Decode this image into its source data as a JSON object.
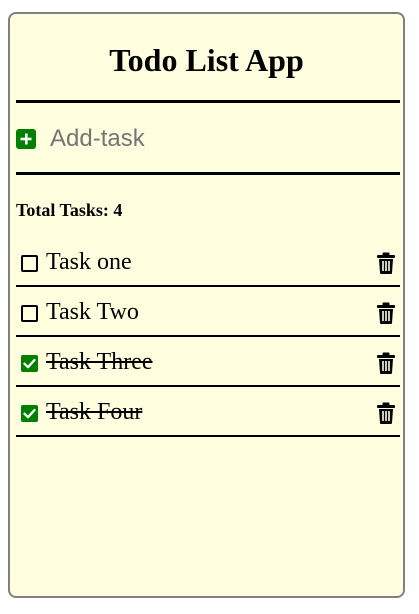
{
  "app": {
    "title": "Todo List App"
  },
  "add_task": {
    "placeholder": "Add-task",
    "value": ""
  },
  "summary": {
    "total_label": "Total Tasks: 4"
  },
  "tasks": [
    {
      "text": "Task one",
      "completed": false
    },
    {
      "text": "Task Two",
      "completed": false
    },
    {
      "text": "Task Three",
      "completed": true
    },
    {
      "text": "Task Four",
      "completed": true
    }
  ],
  "icons": {
    "add": "plus-square-icon",
    "delete": "trash-icon",
    "checked": "check-square-icon",
    "unchecked": "empty-square-icon"
  },
  "colors": {
    "background": "#ffffe0",
    "accent": "#008000",
    "border": "#808080",
    "text": "#000000"
  }
}
